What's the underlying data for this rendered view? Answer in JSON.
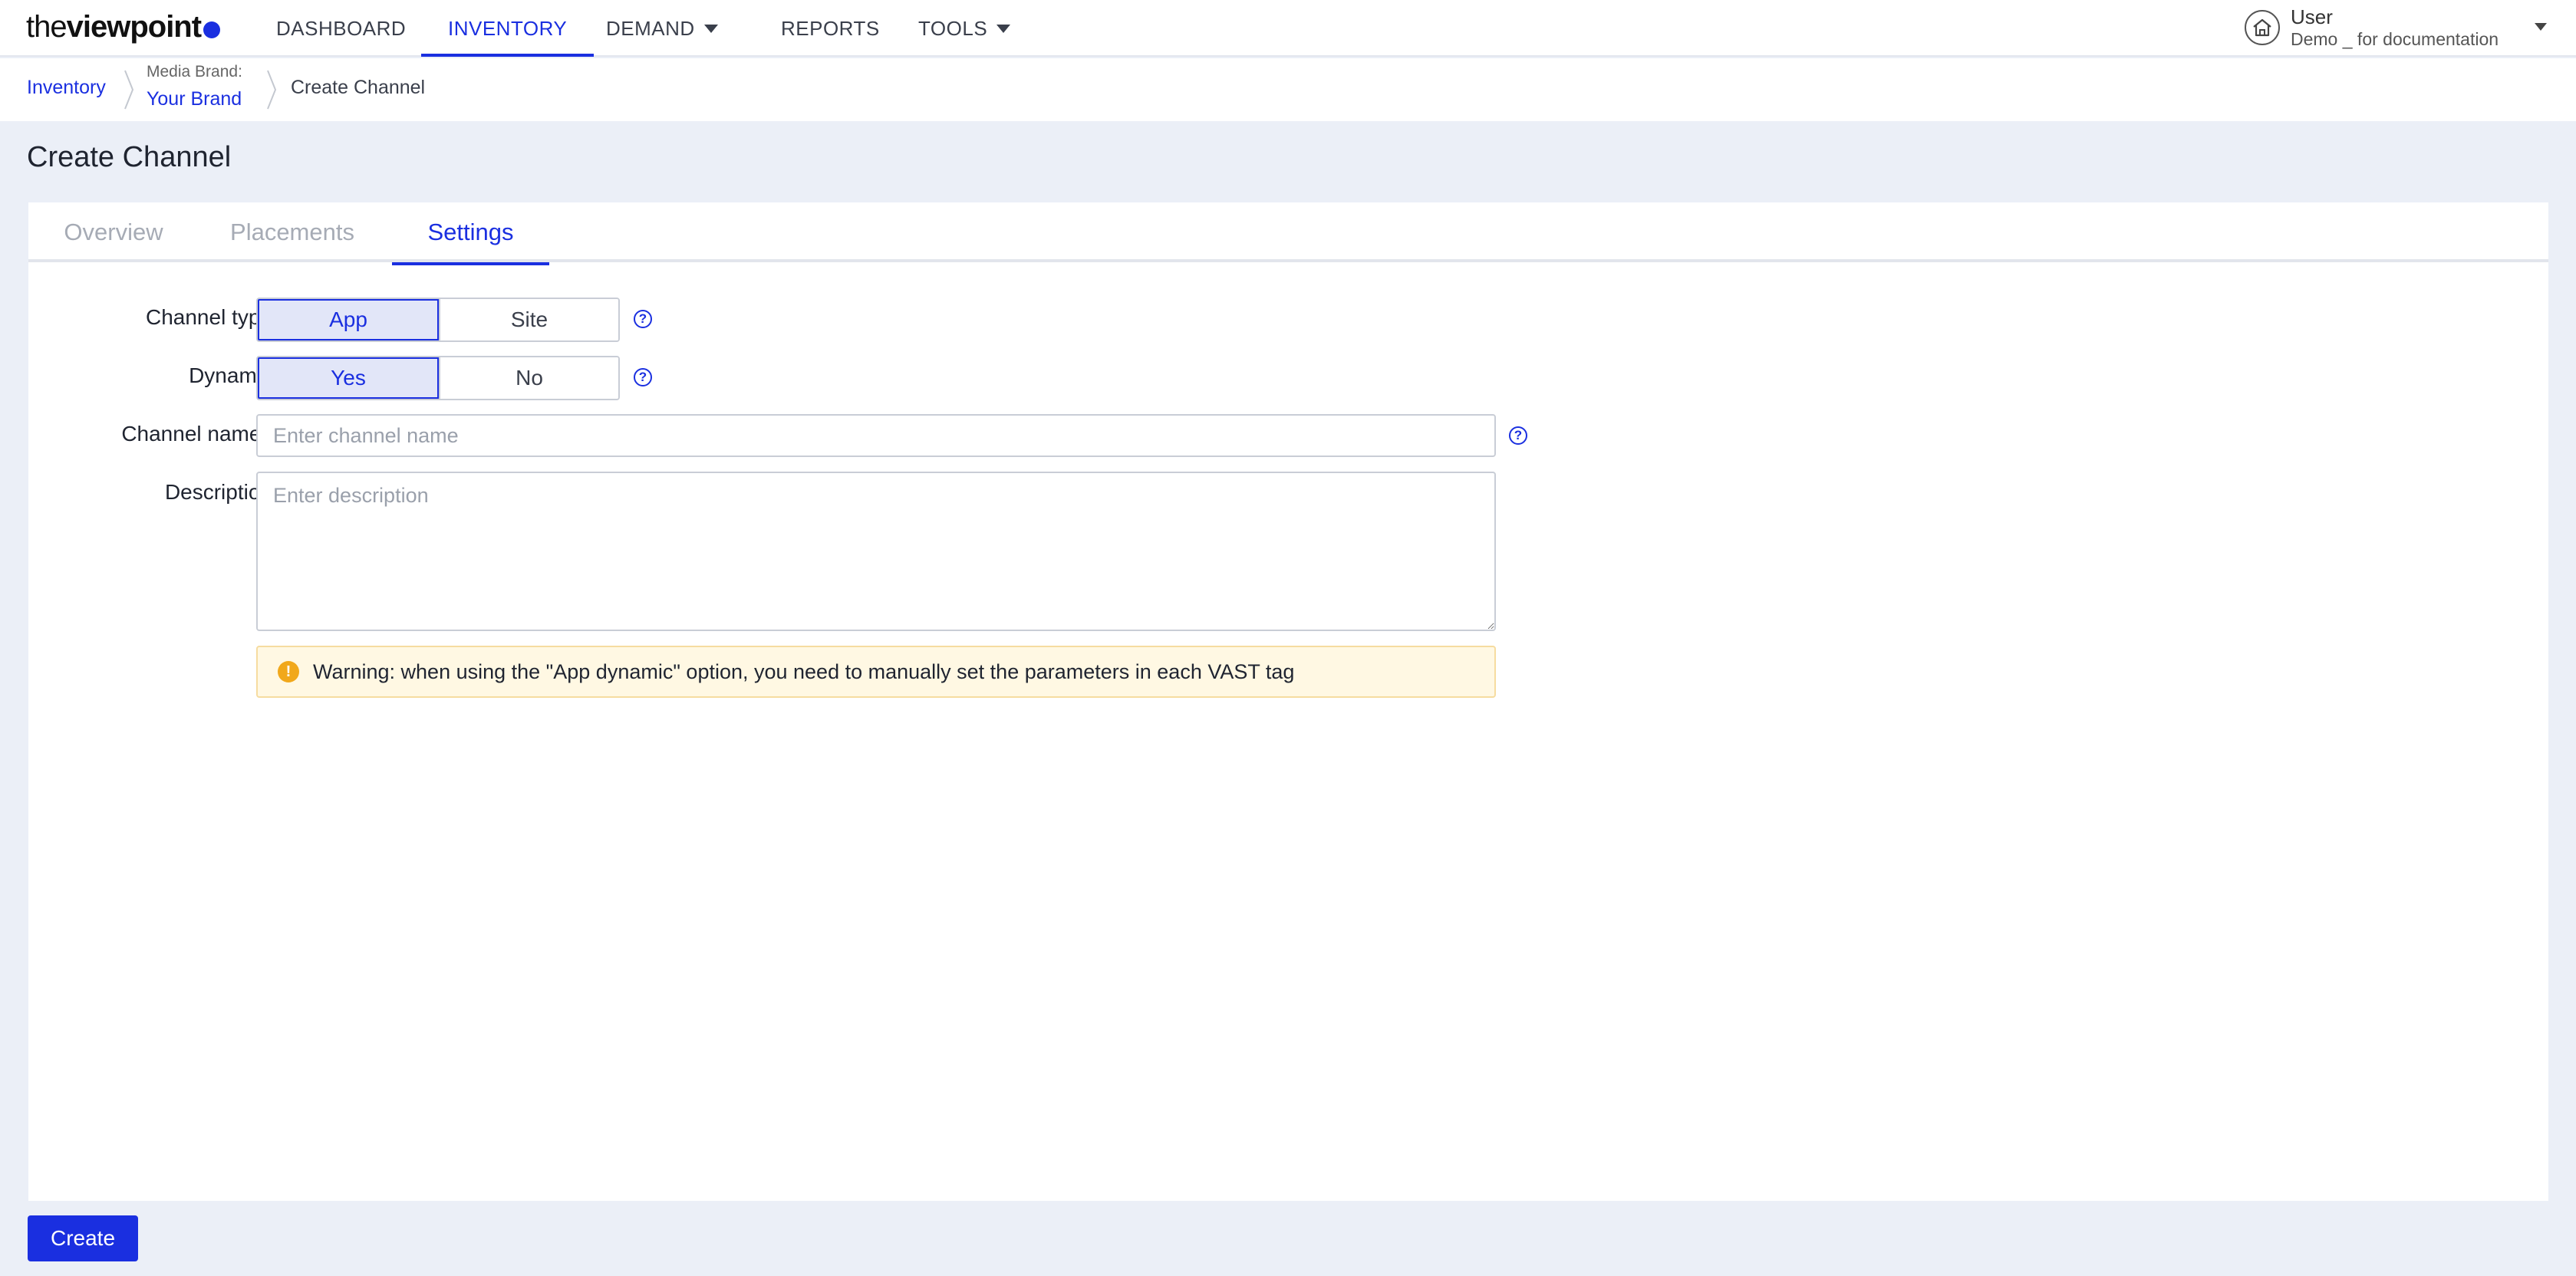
{
  "logo": {
    "light": "the",
    "bold": "viewpoint"
  },
  "nav": {
    "dashboard": "DASHBOARD",
    "inventory": "INVENTORY",
    "demand": "DEMAND",
    "reports": "REPORTS",
    "tools": "TOOLS"
  },
  "user": {
    "name": "User",
    "org": "Demo _ for documentation"
  },
  "breadcrumb": {
    "inventory": "Inventory",
    "brand_label": "Media Brand:",
    "brand": "Your Brand",
    "current": "Create Channel"
  },
  "page_title": "Create Channel",
  "tabs": {
    "overview": "Overview",
    "placements": "Placements",
    "settings": "Settings"
  },
  "form": {
    "channel_type": {
      "label": "Channel type",
      "options": [
        "App",
        "Site"
      ],
      "selected": "App"
    },
    "dynamic": {
      "label": "Dynamic",
      "options": [
        "Yes",
        "No"
      ],
      "selected": "Yes"
    },
    "channel_name": {
      "label": "Channel name",
      "required_mark": "*",
      "placeholder": "Enter channel name",
      "value": ""
    },
    "description": {
      "label": "Description",
      "placeholder": "Enter description",
      "value": ""
    },
    "warning": "Warning: when using the \"App dynamic\" option, you need to manually set the parameters in each VAST tag"
  },
  "actions": {
    "create": "Create"
  },
  "colors": {
    "accent": "#1a2fe0",
    "warning_bg": "#fff8e3",
    "warning_icon": "#f1a81b",
    "page_bg": "#ebeff7"
  }
}
